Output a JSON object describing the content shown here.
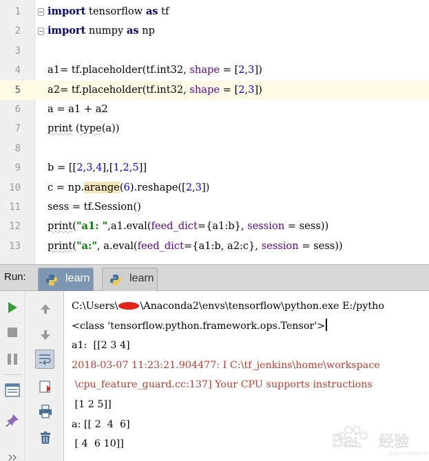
{
  "editor": {
    "current_line": 5,
    "lines": [
      {
        "num": "1",
        "fold": true,
        "tokens": [
          {
            "t": "import",
            "c": "kw"
          },
          {
            "t": " tensorflow "
          },
          {
            "t": "as",
            "c": "kw"
          },
          {
            "t": " tf"
          }
        ]
      },
      {
        "num": "2",
        "fold": true,
        "tokens": [
          {
            "t": "import",
            "c": "kw"
          },
          {
            "t": " numpy "
          },
          {
            "t": "as",
            "c": "kw"
          },
          {
            "t": " np"
          }
        ]
      },
      {
        "num": "3",
        "tokens": []
      },
      {
        "num": "4",
        "tokens": [
          {
            "t": "a1= tf.placeholder(tf.int32, "
          },
          {
            "t": "shape",
            "c": "param"
          },
          {
            "t": " = ["
          },
          {
            "t": "2",
            "c": "num"
          },
          {
            "t": ","
          },
          {
            "t": "3",
            "c": "num"
          },
          {
            "t": "])"
          }
        ]
      },
      {
        "num": "5",
        "tokens": [
          {
            "t": "a2= tf.placeholder(tf.int32, "
          },
          {
            "t": "shape",
            "c": "param"
          },
          {
            "t": " = ["
          },
          {
            "t": "2",
            "c": "num"
          },
          {
            "t": ","
          },
          {
            "t": "3",
            "c": "num"
          },
          {
            "t": "])"
          }
        ]
      },
      {
        "num": "6",
        "tokens": [
          {
            "t": "a = a1 + a2"
          }
        ]
      },
      {
        "num": "7",
        "tokens": [
          {
            "t": "print",
            "c": "kw-plain"
          },
          {
            "t": " ("
          },
          {
            "t": "type",
            "c": "fn"
          },
          {
            "t": "(a))"
          }
        ]
      },
      {
        "num": "8",
        "tokens": []
      },
      {
        "num": "9",
        "tokens": [
          {
            "t": "b = [["
          },
          {
            "t": "2",
            "c": "num"
          },
          {
            "t": ","
          },
          {
            "t": "3",
            "c": "num"
          },
          {
            "t": ","
          },
          {
            "t": "4",
            "c": "num"
          },
          {
            "t": "],["
          },
          {
            "t": "1",
            "c": "num"
          },
          {
            "t": ","
          },
          {
            "t": "2",
            "c": "num"
          },
          {
            "t": ","
          },
          {
            "t": "5",
            "c": "num"
          },
          {
            "t": "]]"
          }
        ]
      },
      {
        "num": "10",
        "tokens": [
          {
            "t": "c = np."
          },
          {
            "t": "arange",
            "c": "hl"
          },
          {
            "t": "("
          },
          {
            "t": "6",
            "c": "num"
          },
          {
            "t": ").reshape(["
          },
          {
            "t": "2",
            "c": "num"
          },
          {
            "t": ","
          },
          {
            "t": "3",
            "c": "num"
          },
          {
            "t": "])"
          }
        ]
      },
      {
        "num": "11",
        "tokens": [
          {
            "t": "sess = tf.Session()"
          }
        ]
      },
      {
        "num": "12",
        "tokens": [
          {
            "t": "print",
            "c": "kw-plain"
          },
          {
            "t": "("
          },
          {
            "t": "\"a1: \"",
            "c": "str"
          },
          {
            "t": ",a1.eval("
          },
          {
            "t": "feed_dict",
            "c": "param"
          },
          {
            "t": "={a1:b}, "
          },
          {
            "t": "session",
            "c": "param"
          },
          {
            "t": " = sess))"
          }
        ]
      },
      {
        "num": "13",
        "tokens": [
          {
            "t": "print",
            "c": "kw-plain"
          },
          {
            "t": "("
          },
          {
            "t": "\"a:\"",
            "c": "str"
          },
          {
            "t": ", a.eval("
          },
          {
            "t": "feed_dict",
            "c": "param"
          },
          {
            "t": "={a1:b, a2:c}, "
          },
          {
            "t": "session",
            "c": "param"
          },
          {
            "t": " = sess))"
          }
        ]
      }
    ]
  },
  "run_panel": {
    "label": "Run:",
    "tabs": [
      {
        "label": "learn",
        "active": true
      },
      {
        "label": "learn",
        "active": false
      }
    ]
  },
  "toolbar": {
    "left_icons": [
      "run-icon",
      "stop-icon",
      "pause-icon",
      "layout-icon",
      "pin-icon",
      "more-icon"
    ],
    "right_icons": [
      "scroll-up-icon",
      "scroll-down-icon",
      "soft-wrap-icon",
      "scroll-to-end-icon",
      "print-icon",
      "trash-icon"
    ]
  },
  "console": {
    "command_prefix": "C:\\Users\\",
    "command_suffix": "\\Anaconda2\\envs\\tensorflow\\python.exe E:/pytho",
    "lines": [
      {
        "text": "<class 'tensorflow.python.framework.ops.Tensor'>",
        "err": false,
        "cursor": true
      },
      {
        "text": "a1:  [[2 3 4]",
        "err": false
      },
      {
        "text": "2018-03-07 11:23:21.904477: I C:\\tf_jenkins\\home\\workspace",
        "err": true
      },
      {
        "text": " \\cpu_feature_guard.cc:137] Your CPU supports instructions",
        "err": true
      },
      {
        "text": " [1 2 5]]",
        "err": false
      },
      {
        "text": "a: [[ 2  4  6]",
        "err": false
      },
      {
        "text": " [ 4  6 10]]",
        "err": false
      }
    ]
  },
  "colors": {
    "keyword": "#000080",
    "number": "#0000ff",
    "string": "#008000",
    "param": "#660099",
    "stderr": "#c0392b",
    "run_green": "#3a9b3a",
    "active_tab": "#7d97b2",
    "current_line": "#fffae3"
  },
  "watermark": {
    "text": "Baidu经验"
  }
}
